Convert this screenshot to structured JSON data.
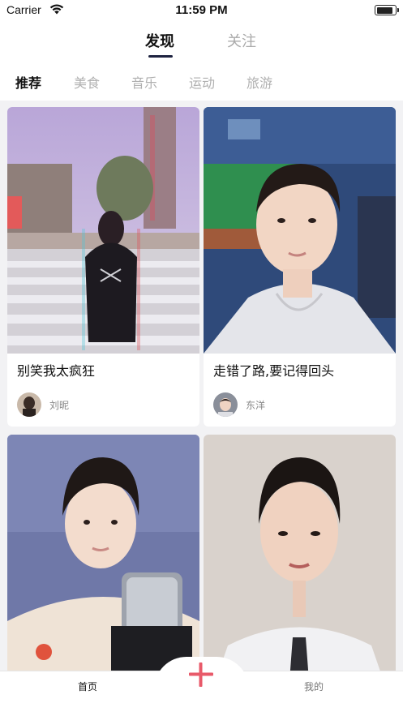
{
  "status": {
    "carrier": "Carrier",
    "time": "11:59 PM"
  },
  "top_tabs": [
    {
      "label": "发现",
      "active": true
    },
    {
      "label": "关注",
      "active": false
    }
  ],
  "categories": [
    {
      "label": "推荐",
      "active": true
    },
    {
      "label": "美食",
      "active": false
    },
    {
      "label": "音乐",
      "active": false
    },
    {
      "label": "运动",
      "active": false
    },
    {
      "label": "旅游",
      "active": false
    }
  ],
  "feed": [
    {
      "title": "别笑我太疯狂",
      "user": "刘昵"
    },
    {
      "title": "走错了路,要记得回头",
      "user": "东洋"
    },
    {
      "title": "",
      "user": ""
    },
    {
      "title": "",
      "user": ""
    }
  ],
  "tabbar": {
    "home_label": "首页",
    "me_label": "我的",
    "add_icon": "plus-icon"
  },
  "colors": {
    "accent": "#e85a6a",
    "underline": "#1e2340",
    "background": "#f2f2f4"
  }
}
